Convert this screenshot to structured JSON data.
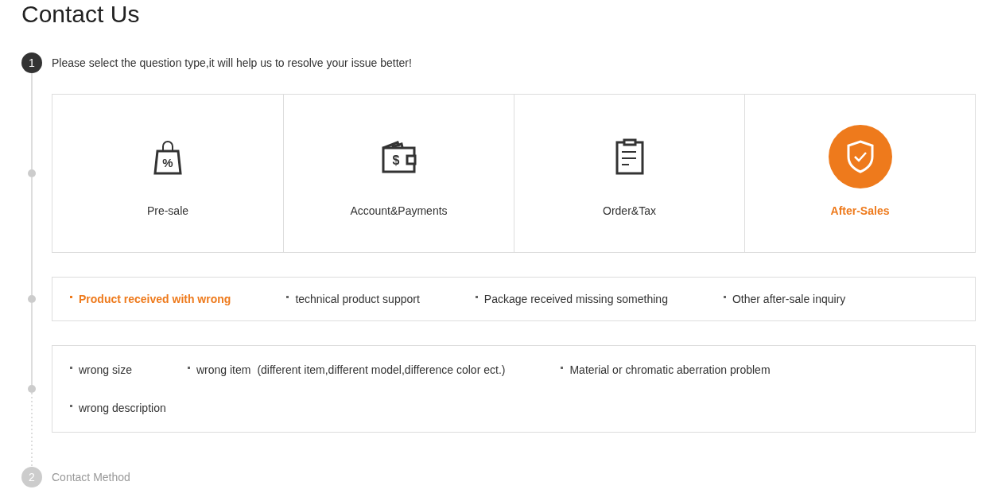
{
  "title": "Contact Us",
  "steps": [
    {
      "number": "1",
      "label": "Please select the question type,it will help us to resolve your issue better!",
      "active": true
    },
    {
      "number": "2",
      "label": "Contact Method",
      "active": false
    }
  ],
  "categories": [
    {
      "kind": "bag",
      "symbol": "%",
      "label": "Pre-sale",
      "selected": false
    },
    {
      "kind": "wallet",
      "symbol": "$",
      "label": "Account&Payments",
      "selected": false
    },
    {
      "kind": "clipboard",
      "label": "Order&Tax",
      "selected": false
    },
    {
      "kind": "shield",
      "label": "After-Sales",
      "selected": true
    }
  ],
  "subtypes": [
    {
      "label": "Product received with wrong",
      "selected": true
    },
    {
      "label": "technical product support",
      "selected": false
    },
    {
      "label": "Package received missing something",
      "selected": false
    },
    {
      "label": "Other after-sale inquiry",
      "selected": false
    }
  ],
  "details": [
    {
      "label": "wrong size"
    },
    {
      "label": "wrong item",
      "note": "(different item,different model,difference color ect.)"
    },
    {
      "label": "Material or chromatic aberration problem"
    },
    {
      "label": "wrong description"
    }
  ]
}
